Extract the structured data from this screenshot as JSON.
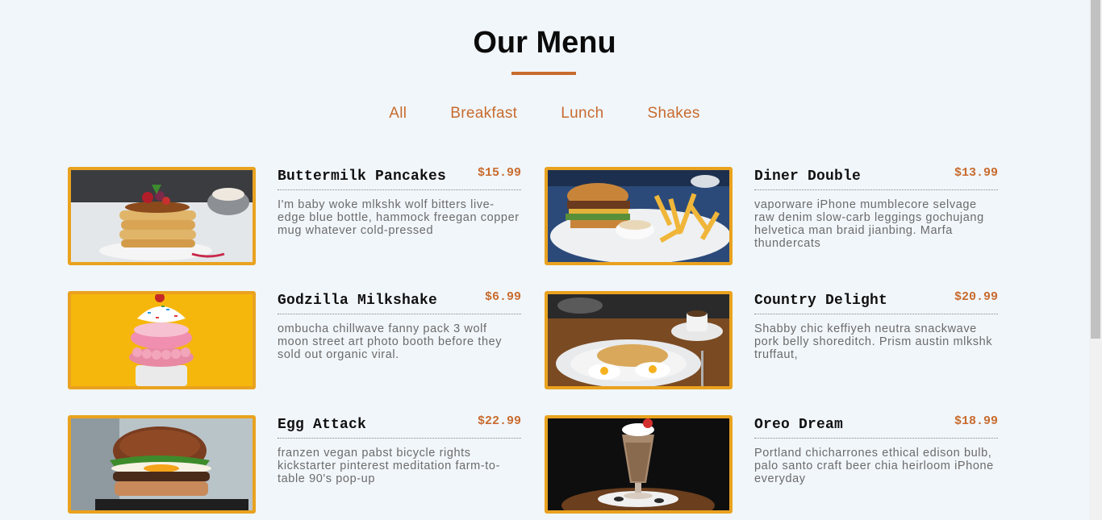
{
  "header": {
    "title": "Our Menu"
  },
  "filters": [
    "All",
    "Breakfast",
    "Lunch",
    "Shakes"
  ],
  "menu": [
    {
      "name": "Buttermilk Pancakes",
      "price": "$15.99",
      "desc": "I'm baby woke mlkshk wolf bitters live-edge blue bottle, hammock freegan copper mug whatever cold-pressed",
      "image": "pancakes"
    },
    {
      "name": "Diner Double",
      "price": "$13.99",
      "desc": "vaporware iPhone mumblecore selvage raw denim slow-carb leggings gochujang helvetica man braid jianbing. Marfa thundercats",
      "image": "burger-fries"
    },
    {
      "name": "Godzilla Milkshake",
      "price": "$6.99",
      "desc": "ombucha chillwave fanny pack 3 wolf moon street art photo booth before they sold out organic viral.",
      "image": "milkshake-donut"
    },
    {
      "name": "Country Delight",
      "price": "$20.99",
      "desc": "Shabby chic keffiyeh neutra snackwave pork belly shoreditch. Prism austin mlkshk truffaut,",
      "image": "eggs-toast"
    },
    {
      "name": "Egg Attack",
      "price": "$22.99",
      "desc": "franzen vegan pabst bicycle rights kickstarter pinterest meditation farm-to-table 90's pop-up",
      "image": "egg-burger"
    },
    {
      "name": "Oreo Dream",
      "price": "$18.99",
      "desc": "Portland chicharrones ethical edison bulb, palo santo craft beer chia heirloom iPhone everyday",
      "image": "oreo-shake"
    }
  ],
  "colors": {
    "accent": "#c86b2e",
    "frame": "#e9a21f",
    "background": "#f1f6fb"
  }
}
